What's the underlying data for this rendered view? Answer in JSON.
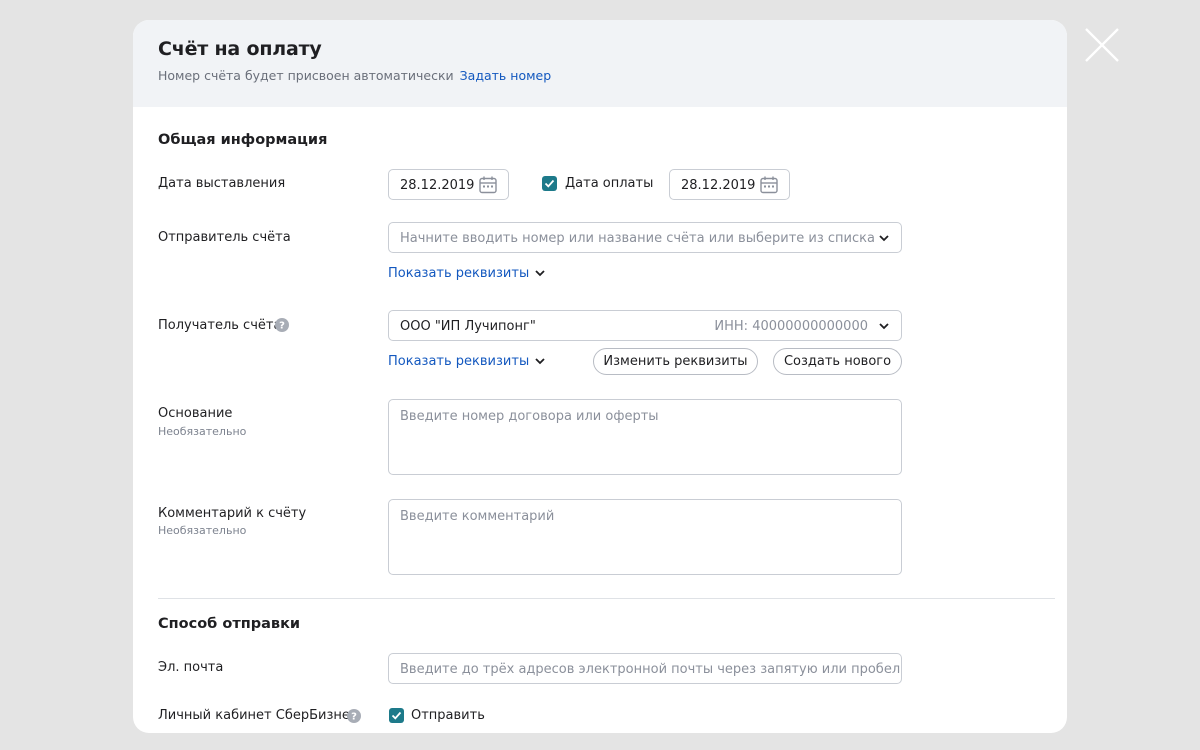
{
  "header": {
    "title": "Счёт на оплату",
    "subtitle": "Номер счёта будет присвоен автоматически",
    "set_number_link": "Задать номер"
  },
  "general": {
    "section_title": "Общая информация",
    "issue_date_label": "Дата выставления",
    "issue_date_value": "28.12.2019",
    "payment_date_checkbox_label": "Дата оплаты",
    "payment_date_checked": true,
    "payment_date_value": "28.12.2019",
    "sender_label": "Отправитель счёта",
    "sender_placeholder": "Начните вводить номер или название счёта или выберите из списка",
    "sender_details_link": "Показать реквизиты",
    "recipient_label": "Получатель счёта",
    "recipient_value": "ООО \"ИП Лучипонг\"",
    "recipient_inn": "ИНН: 40000000000000",
    "recipient_details_link": "Показать реквизиты",
    "change_details_button": "Изменить реквизиты",
    "create_new_button": "Создать нового",
    "basis_label": "Основание",
    "basis_hint": "Необязательно",
    "basis_placeholder": "Введите номер договора или оферты",
    "comment_label": "Комментарий к счёту",
    "comment_hint": "Необязательно",
    "comment_placeholder": "Введите комментарий"
  },
  "delivery": {
    "section_title": "Способ отправки",
    "email_label": "Эл. почта",
    "email_placeholder": "Введите до трёх адресов электронной почты через запятую или пробел",
    "cabinet_label": "Личный кабинет СберБизнес",
    "send_checkbox_label": "Отправить",
    "send_checked": true
  },
  "colors": {
    "accent_link": "#1358bf",
    "checkbox": "#1d7a8a",
    "header_bg": "#f1f3f6",
    "backdrop": "#e4e4e4"
  }
}
